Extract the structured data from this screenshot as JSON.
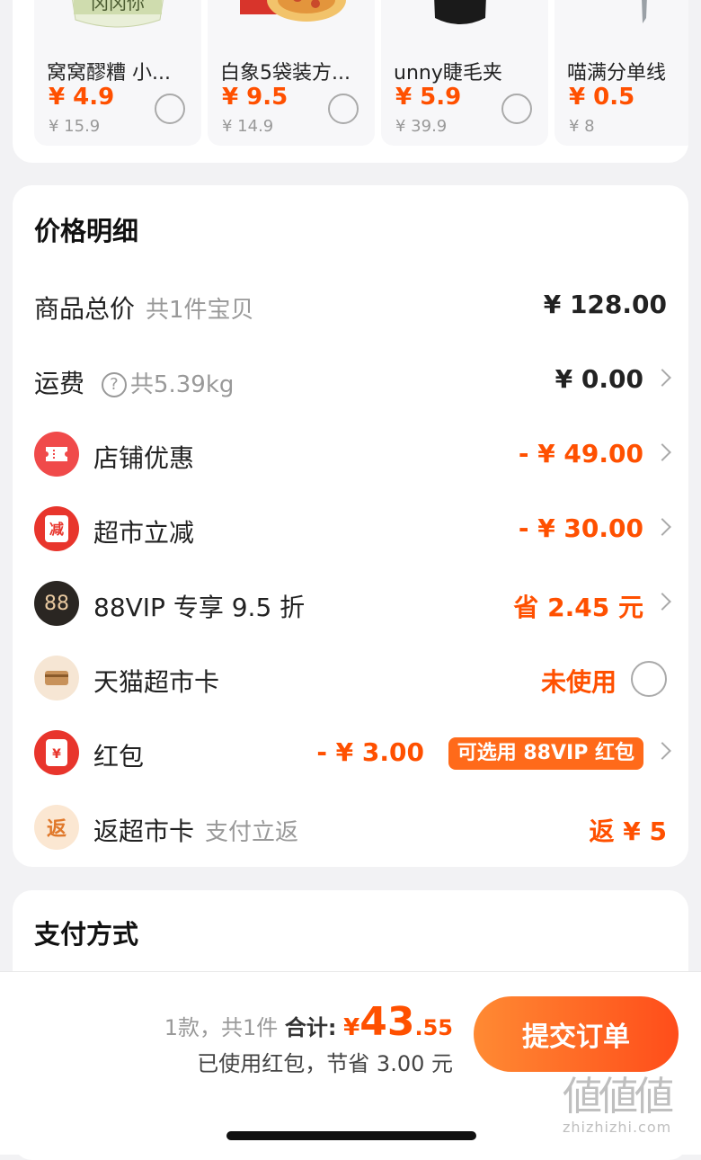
{
  "recommendations": [
    {
      "name": "窝窝醪糟 小...",
      "price": "¥ 4.9",
      "original": "¥ 15.9",
      "icon": "fermented-rice-jar-image"
    },
    {
      "name": "白象5袋装方...",
      "price": "¥ 9.5",
      "original": "¥ 14.9",
      "icon": "noodle-box-image"
    },
    {
      "name": "unny睫毛夹",
      "price": "¥ 5.9",
      "original": "¥ 39.9",
      "icon": "eyelash-curler-image"
    },
    {
      "name": "喵满分单线",
      "price": "¥ 0.5",
      "original": "¥ 8",
      "icon": "floss-image"
    }
  ],
  "price_detail": {
    "title": "价格明细",
    "rows": [
      {
        "label": "商品总价",
        "sub": "共1件宝贝",
        "value": "¥ 128.00"
      },
      {
        "label": "运费",
        "sub": "共5.39kg",
        "value": "¥ 0.00"
      },
      {
        "label": "店铺优惠",
        "value": "- ¥ 49.00",
        "icon": "ticket-icon"
      },
      {
        "label": "超市立减",
        "value": "- ¥ 30.00",
        "icon": "discount-icon",
        "icon_text": "减"
      },
      {
        "label": "88VIP 专享 9.5 折",
        "value": "省 2.45 元",
        "icon": "88vip-icon",
        "icon_text": "88"
      },
      {
        "label": "天猫超市卡",
        "value": "未使用",
        "icon": "card-icon"
      },
      {
        "label": "红包",
        "value": "- ¥ 3.00",
        "tag": "可选用 88VIP 红包",
        "icon": "red-packet-icon",
        "icon_text": "¥"
      },
      {
        "label": "返超市卡",
        "sub": "支付立返",
        "value": "返 ¥ 5",
        "icon": "cashback-icon",
        "icon_text": "返"
      }
    ]
  },
  "payment": {
    "title": "支付方式"
  },
  "bottom_bar": {
    "count": "1款，共1件",
    "total_label": "合计:",
    "currency": "¥",
    "total_int": "43",
    "total_dec": ".55",
    "saving": "已使用红包，节省 3.00 元",
    "submit": "提交订单"
  },
  "watermark": {
    "glyphs": "値値値",
    "url": "zhizhizhi.com"
  },
  "colors": {
    "accent": "#ff5000",
    "button_start": "#ff8a33",
    "button_end": "#ff4d1a",
    "bg": "#f2f2f4"
  }
}
